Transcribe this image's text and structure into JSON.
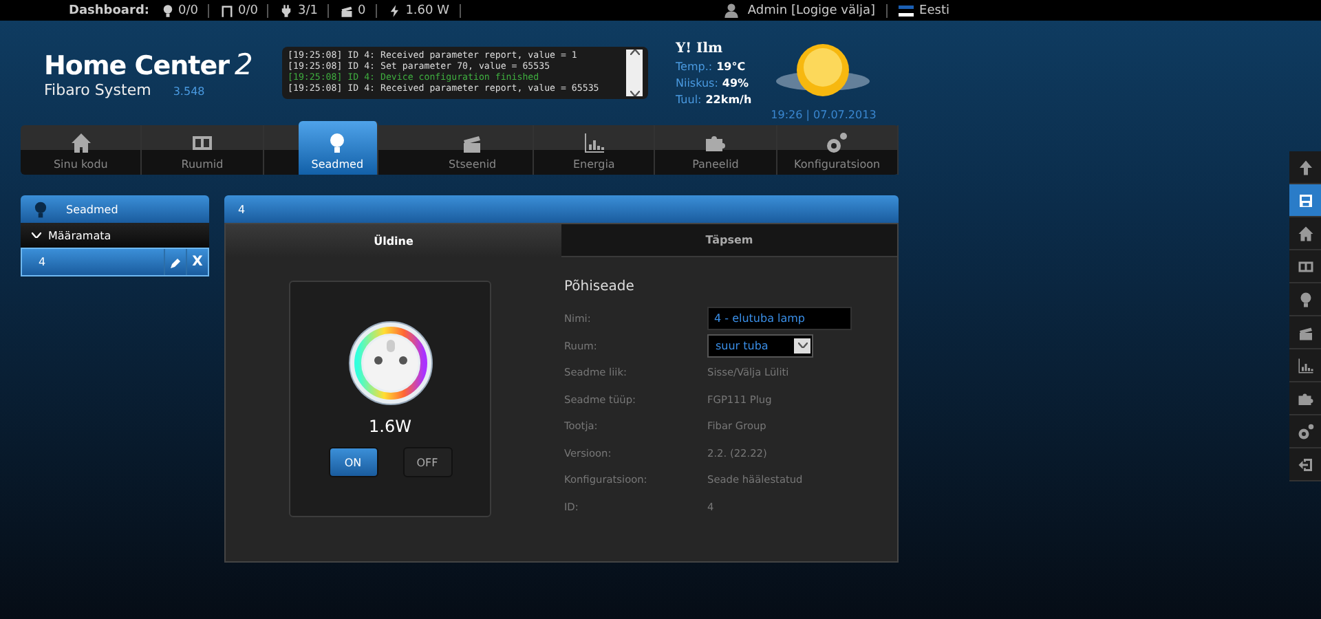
{
  "top_bar": {
    "label": "Dashboard:",
    "stats": [
      {
        "text": "0/0"
      },
      {
        "text": "0/0"
      },
      {
        "text": "3/1"
      },
      {
        "text": "0"
      },
      {
        "text": "1.60 W"
      }
    ],
    "user": "Admin [Logige välja]",
    "language": "Eesti"
  },
  "logo": {
    "title": "Home Center",
    "number": "2",
    "subtitle": "Fibaro System",
    "version": "3.548"
  },
  "log": {
    "lines": [
      {
        "kind": "info",
        "text": "[19:25:08] ID 4: Received parameter report, value = 1"
      },
      {
        "kind": "info",
        "text": "[19:25:08] ID 4: Set parameter 70, value = 65535"
      },
      {
        "kind": "success",
        "text": "[19:25:08] ID 4: Device configuration finished"
      },
      {
        "kind": "info",
        "text": "[19:25:08] ID 4: Received parameter report, value = 65535"
      }
    ]
  },
  "weather": {
    "brand_mark": "Y!",
    "brand": "Ilm",
    "rows": [
      {
        "label": "Temp.:",
        "value": "19°C"
      },
      {
        "label": "Niiskus:",
        "value": "49%"
      },
      {
        "label": "Tuul:",
        "value": "22km/h"
      }
    ],
    "datetime": "19:26 | 07.07.2013"
  },
  "nav": [
    {
      "label": "Sinu kodu",
      "selected": false
    },
    {
      "label": "Ruumid",
      "selected": false
    },
    {
      "label": "Seadmed",
      "selected": true
    },
    {
      "label": "Stseenid",
      "selected": false
    },
    {
      "label": "Energia",
      "selected": false
    },
    {
      "label": "Paneelid",
      "selected": false
    },
    {
      "label": "Konfiguratsioon",
      "selected": false
    }
  ],
  "sidebar": {
    "title": "Seadmed",
    "groups": [
      {
        "label": "Määramata",
        "expanded": true,
        "items": [
          {
            "label": "4",
            "selected": true,
            "delete": "X"
          }
        ]
      }
    ]
  },
  "panel": {
    "title": "4",
    "tabs": [
      {
        "label": "Üldine",
        "selected": true
      },
      {
        "label": "Täpsem",
        "selected": false
      }
    ],
    "device": {
      "power": "1.6W",
      "buttons": [
        {
          "label": "ON",
          "selected": true
        },
        {
          "label": "OFF",
          "selected": false
        }
      ]
    },
    "section": "Põhiseade",
    "fields": [
      {
        "kind": "input",
        "label": "Nimi:",
        "value": "4 - elutuba lamp"
      },
      {
        "kind": "select",
        "label": "Ruum:",
        "value": "suur tuba"
      },
      {
        "kind": "text",
        "label": "Seadme liik:",
        "value": "Sisse/Välja Lüliti"
      },
      {
        "kind": "text",
        "label": "Seadme tüüp:",
        "value": "FGP111 Plug"
      },
      {
        "kind": "text",
        "label": "Tootja:",
        "value": "Fibar Group"
      },
      {
        "kind": "text",
        "label": "Versioon:",
        "value": "2.2. (22.22)"
      },
      {
        "kind": "text",
        "label": "Konfiguratsioon:",
        "value": "Seade häälestatud"
      },
      {
        "kind": "text",
        "label": "ID:",
        "value": "4"
      }
    ]
  },
  "toolbar": [
    {
      "selected": false
    },
    {
      "selected": true
    },
    {
      "selected": false
    },
    {
      "selected": false
    },
    {
      "selected": false
    },
    {
      "selected": false
    },
    {
      "selected": false
    },
    {
      "selected": false
    },
    {
      "selected": false
    },
    {
      "selected": false
    }
  ]
}
